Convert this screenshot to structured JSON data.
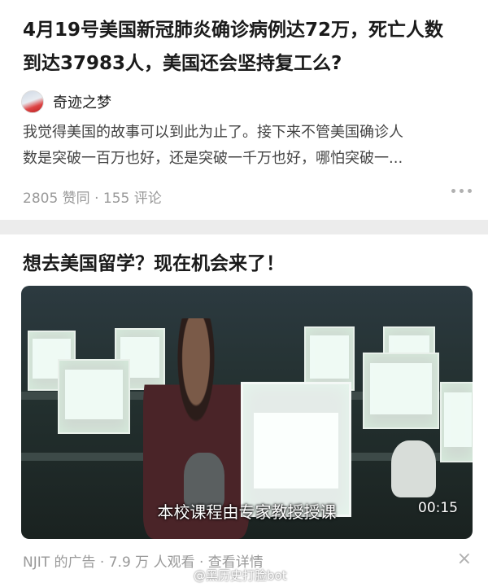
{
  "post": {
    "title_line1": "4月19号美国新冠肺炎确诊病例达72万，死亡人数",
    "title_line2": "到达37983人，美国还会坚持复工么?",
    "author": "奇迹之梦",
    "excerpt_line1": "我觉得美国的故事可以到此为止了。接下来不管美国确诊人",
    "excerpt_line2": "数是突破一百万也好，还是突破一千万也好，哪怕突破一...",
    "meta": "2805 赞同 · 155 评论",
    "more_icon": "more-dots-icon"
  },
  "ad": {
    "title": "想去美国留学？现在机会来了！",
    "video_subtitle": "本校课程由专家教授授课",
    "video_duration": "00:15",
    "meta": "NJIT 的广告 · 7.9 万 人观看 · 查看详情",
    "close_label": "×"
  },
  "watermark": "@黑历史打脸bot"
}
